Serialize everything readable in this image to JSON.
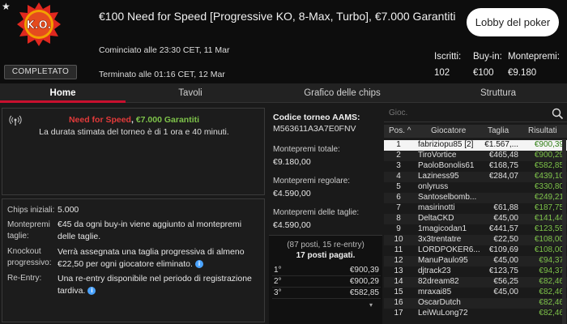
{
  "header": {
    "title": "€100 Need for Speed [Progressive KO, 8-Max, Turbo], €7.000 Garantiti",
    "badge_text": "K.O.",
    "status": "COMPLETATO",
    "started": "Cominciato alle 23:30 CET, 11 Mar",
    "ended": "Terminato alle 01:16 CET, 12 Mar",
    "lobby_button": "Lobby del poker",
    "stats": {
      "entrants_label": "Iscritti:",
      "entrants": "102",
      "buyin_label": "Buy-in:",
      "buyin": "€100",
      "prize_label": "Montepremi:",
      "prize": "€9.180"
    }
  },
  "tabs": [
    "Home",
    "Tavoli",
    "Grafico delle chips",
    "Struttura"
  ],
  "info": {
    "promo_name": "Need for Speed",
    "promo_sep": ",",
    "promo_guarantee": "€7.000 Garantiti",
    "duration": "La durata stimata del torneo è di 1 ora e 40 minuti."
  },
  "rules": [
    {
      "label": "Chips iniziali:",
      "text": "5.000"
    },
    {
      "label": "Montepremi taglie:",
      "text": "€45 da ogni buy-in viene aggiunto al montepremi delle taglie."
    },
    {
      "label": "Knockout progressivo:",
      "text": "Verrà assegnata una taglia progressiva di almeno €22,50 per ogni giocatore eliminato."
    },
    {
      "label": "Re-Entry:",
      "text": "Una re-entry disponibile nel periodo di registrazione tardiva."
    }
  ],
  "middle": {
    "code_title": "Codice torneo AAMS:",
    "code": "M563611A3A7E0FNV",
    "total_label": "Montepremi totale:",
    "total": "€9.180,00",
    "regular_label": "Montepremi regolare:",
    "regular": "€4.590,00",
    "bounty_label": "Montepremi delle taglie:",
    "bounty": "€4.590,00",
    "entries": "(87 posti, 15 re-entry)",
    "paid": "17 posti pagati.",
    "prizes": [
      {
        "rank": "1°",
        "amount": "€900,39"
      },
      {
        "rank": "2°",
        "amount": "€900,29"
      },
      {
        "rank": "3°",
        "amount": "€582,85"
      }
    ]
  },
  "table": {
    "search_placeholder": "Gioc.",
    "headers": {
      "pos": "Pos.",
      "player": "Giocatore",
      "bounty": "Taglia",
      "result": "Risultati"
    },
    "rows": [
      {
        "pos": "1",
        "name": "fabriziopu85 [2]",
        "bounty": "€1.567,...",
        "result": "€900,39"
      },
      {
        "pos": "2",
        "name": "TiroVortice",
        "bounty": "€465,48",
        "result": "€900,29"
      },
      {
        "pos": "3",
        "name": "PaoloBonolis61",
        "bounty": "€168,75",
        "result": "€582,85"
      },
      {
        "pos": "4",
        "name": "Laziness95",
        "bounty": "€284,07",
        "result": "€439,10"
      },
      {
        "pos": "5",
        "name": "onlyruss",
        "bounty": "",
        "result": "€330,80"
      },
      {
        "pos": "6",
        "name": "Santoselbomb...",
        "bounty": "",
        "result": "€249,21"
      },
      {
        "pos": "7",
        "name": "masirinotti",
        "bounty": "€61,88",
        "result": "€187,75"
      },
      {
        "pos": "8",
        "name": "DeltaCKD",
        "bounty": "€45,00",
        "result": "€141,44"
      },
      {
        "pos": "9",
        "name": "1magicodan1",
        "bounty": "€441,57",
        "result": "€123,59"
      },
      {
        "pos": "10",
        "name": "3x3trentatre",
        "bounty": "€22,50",
        "result": "€108,00"
      },
      {
        "pos": "11",
        "name": "LORDPOKER6...",
        "bounty": "€109,69",
        "result": "€108,00"
      },
      {
        "pos": "12",
        "name": "ManuPaulo95",
        "bounty": "€45,00",
        "result": "€94,37"
      },
      {
        "pos": "13",
        "name": "djtrack23",
        "bounty": "€123,75",
        "result": "€94,37"
      },
      {
        "pos": "14",
        "name": "82dream82",
        "bounty": "€56,25",
        "result": "€82,46"
      },
      {
        "pos": "15",
        "name": "mraxai85",
        "bounty": "€45,00",
        "result": "€82,46"
      },
      {
        "pos": "16",
        "name": "OscarDutch",
        "bounty": "",
        "result": "€82,46"
      },
      {
        "pos": "17",
        "name": "LeiWuLong72",
        "bounty": "",
        "result": "€82,46"
      }
    ]
  },
  "colors": {
    "accent": "#c8102e",
    "green": "#7ec34a",
    "promo_red": "#e23a3a"
  }
}
